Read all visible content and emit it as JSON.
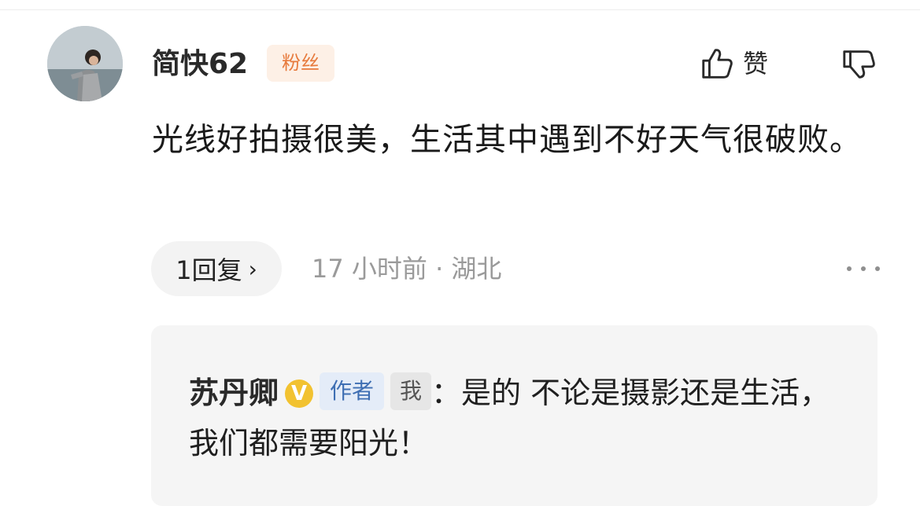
{
  "comment": {
    "username": "简快62",
    "badge": "粉丝",
    "like_label": "赞",
    "text": "光线好拍摄很美，生活其中遇到不好天气很破败。",
    "reply_button": "1回复",
    "reply_chevron": "›",
    "meta": "17 小时前 · 湖北"
  },
  "icons": {
    "avatar": "avatar",
    "like": "thumb-up-icon",
    "dislike": "thumb-down-icon",
    "more": "more-horizontal-icon",
    "verified": "verified-v-icon"
  },
  "reply": {
    "author": "苏丹卿",
    "verified_mark": "V",
    "author_tag": "作者",
    "me_tag": "我",
    "text": "：是的 不论是摄影还是生活，我们都需要阳光！"
  },
  "colors": {
    "badge_bg": "#fdf0e6",
    "badge_text": "#e77a3c",
    "author_tag_bg": "#e4ecf8",
    "author_tag_text": "#3f6fb3",
    "verified": "#f2c230"
  }
}
